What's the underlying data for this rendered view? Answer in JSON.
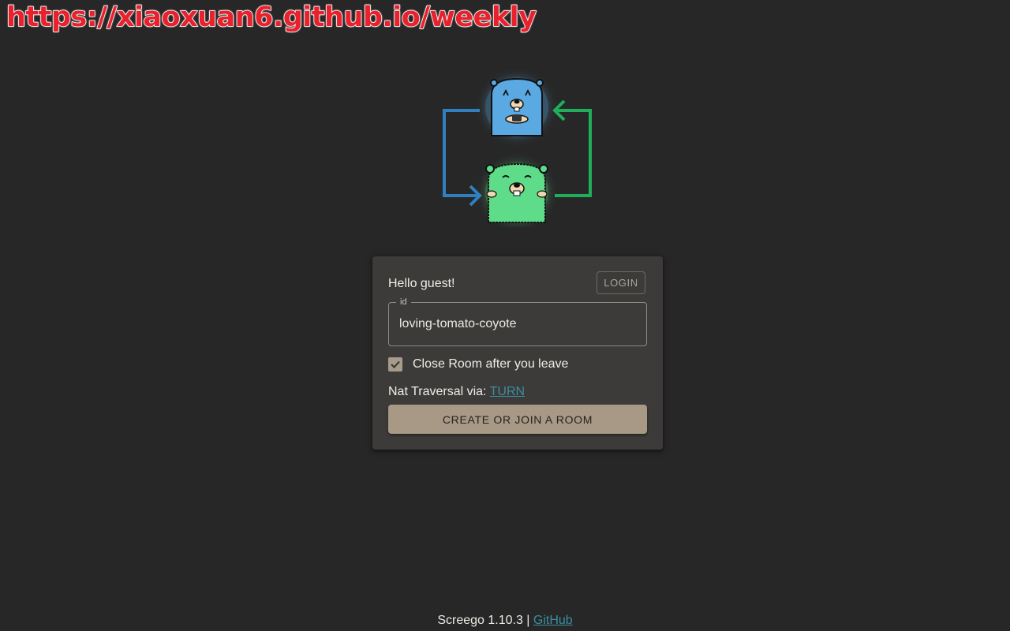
{
  "watermark": {
    "text": "https://xiaoxuan6.github.io/weekly"
  },
  "logo": {
    "icon": "screego-gopher-logo",
    "colors": {
      "blue": "#2f7fc1",
      "green": "#1fae5a",
      "gopher_blue": "#5aa9e2",
      "gopher_green": "#5fdc8a"
    }
  },
  "card": {
    "greeting": "Hello guest!",
    "login_label": "LOGIN",
    "id_field": {
      "label": "id",
      "value": "loving-tomato-coyote"
    },
    "close_room": {
      "label": "Close Room after you leave",
      "checked": true
    },
    "nat": {
      "prefix": "Nat Traversal via: ",
      "link": "TURN"
    },
    "create_label": "CREATE OR JOIN A ROOM"
  },
  "footer": {
    "version": "Screego 1.10.3 | ",
    "link": "GitHub"
  },
  "colors": {
    "background": "#272727",
    "card": "#3c3b39",
    "accent": "#a79985",
    "link": "#3b8ea0"
  }
}
